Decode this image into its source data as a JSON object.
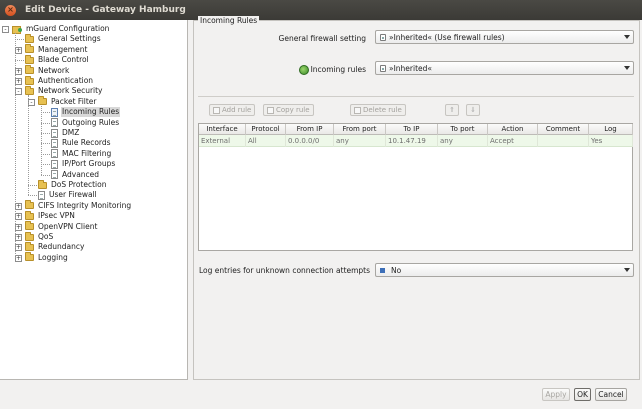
{
  "window": {
    "title": "Edit Device - Gateway Hamburg",
    "close_symbol": "×"
  },
  "tree": {
    "items": [
      {
        "id": "root",
        "label": "mGuard Configuration",
        "icon": "device-icon",
        "expander": "-"
      },
      {
        "id": "general",
        "label": "General Settings",
        "icon": "folder-icon"
      },
      {
        "id": "management",
        "label": "Management",
        "icon": "folder-icon",
        "expander": "+"
      },
      {
        "id": "blade",
        "label": "Blade Control",
        "icon": "folder-icon"
      },
      {
        "id": "network",
        "label": "Network",
        "icon": "folder-icon",
        "expander": "+"
      },
      {
        "id": "auth",
        "label": "Authentication",
        "icon": "folder-icon",
        "expander": "+"
      },
      {
        "id": "netsec",
        "label": "Network Security",
        "icon": "folder-icon",
        "expander": "-"
      },
      {
        "id": "packetfilter",
        "label": "Packet Filter",
        "icon": "folder-icon",
        "expander": "-"
      },
      {
        "id": "incoming",
        "label": "Incoming Rules",
        "icon": "document-icon",
        "selected": true
      },
      {
        "id": "outgoing",
        "label": "Outgoing Rules",
        "icon": "document-icon"
      },
      {
        "id": "dmz",
        "label": "DMZ",
        "icon": "document-icon"
      },
      {
        "id": "rulerecords",
        "label": "Rule Records",
        "icon": "document-icon"
      },
      {
        "id": "mac",
        "label": "MAC Filtering",
        "icon": "document-icon"
      },
      {
        "id": "ipport",
        "label": "IP/Port Groups",
        "icon": "document-icon"
      },
      {
        "id": "advanced",
        "label": "Advanced",
        "icon": "document-icon"
      },
      {
        "id": "dos",
        "label": "DoS Protection",
        "icon": "folder-icon"
      },
      {
        "id": "userfw",
        "label": "User Firewall",
        "icon": "document-icon"
      },
      {
        "id": "cifs",
        "label": "CIFS Integrity Monitoring",
        "icon": "folder-icon",
        "expander": "+"
      },
      {
        "id": "ipsec",
        "label": "IPsec VPN",
        "icon": "folder-icon",
        "expander": "+"
      },
      {
        "id": "openvpn",
        "label": "OpenVPN Client",
        "icon": "folder-icon",
        "expander": "+"
      },
      {
        "id": "qos",
        "label": "QoS",
        "icon": "folder-icon",
        "expander": "+"
      },
      {
        "id": "redundancy",
        "label": "Redundancy",
        "icon": "folder-icon",
        "expander": "+"
      },
      {
        "id": "logging",
        "label": "Logging",
        "icon": "folder-icon",
        "expander": "+"
      }
    ]
  },
  "main": {
    "group_title": "Incoming Rules",
    "general_firewall": {
      "label": "General firewall setting",
      "value": "»Inherited« (Use firewall rules)"
    },
    "incoming_rules": {
      "label": "Incoming rules",
      "value": "»Inherited«"
    },
    "toolbar": {
      "add_rule": "Add rule",
      "copy_rule": "Copy rule",
      "delete_rule": "Delete rule",
      "move_up": "⇑",
      "move_down": "⇓"
    },
    "table": {
      "columns": [
        "Interface",
        "Protocol",
        "From IP",
        "From port",
        "To IP",
        "To port",
        "Action",
        "Comment",
        "Log"
      ],
      "rows": [
        [
          "External",
          "All",
          "0.0.0.0/0",
          "any",
          "10.1.47.19",
          "any",
          "Accept",
          "",
          "Yes"
        ]
      ]
    },
    "log_unknown": {
      "label": "Log entries for unknown connection attempts",
      "value": "No"
    }
  },
  "buttons": {
    "apply": "Apply",
    "ok": "OK",
    "cancel": "Cancel"
  }
}
